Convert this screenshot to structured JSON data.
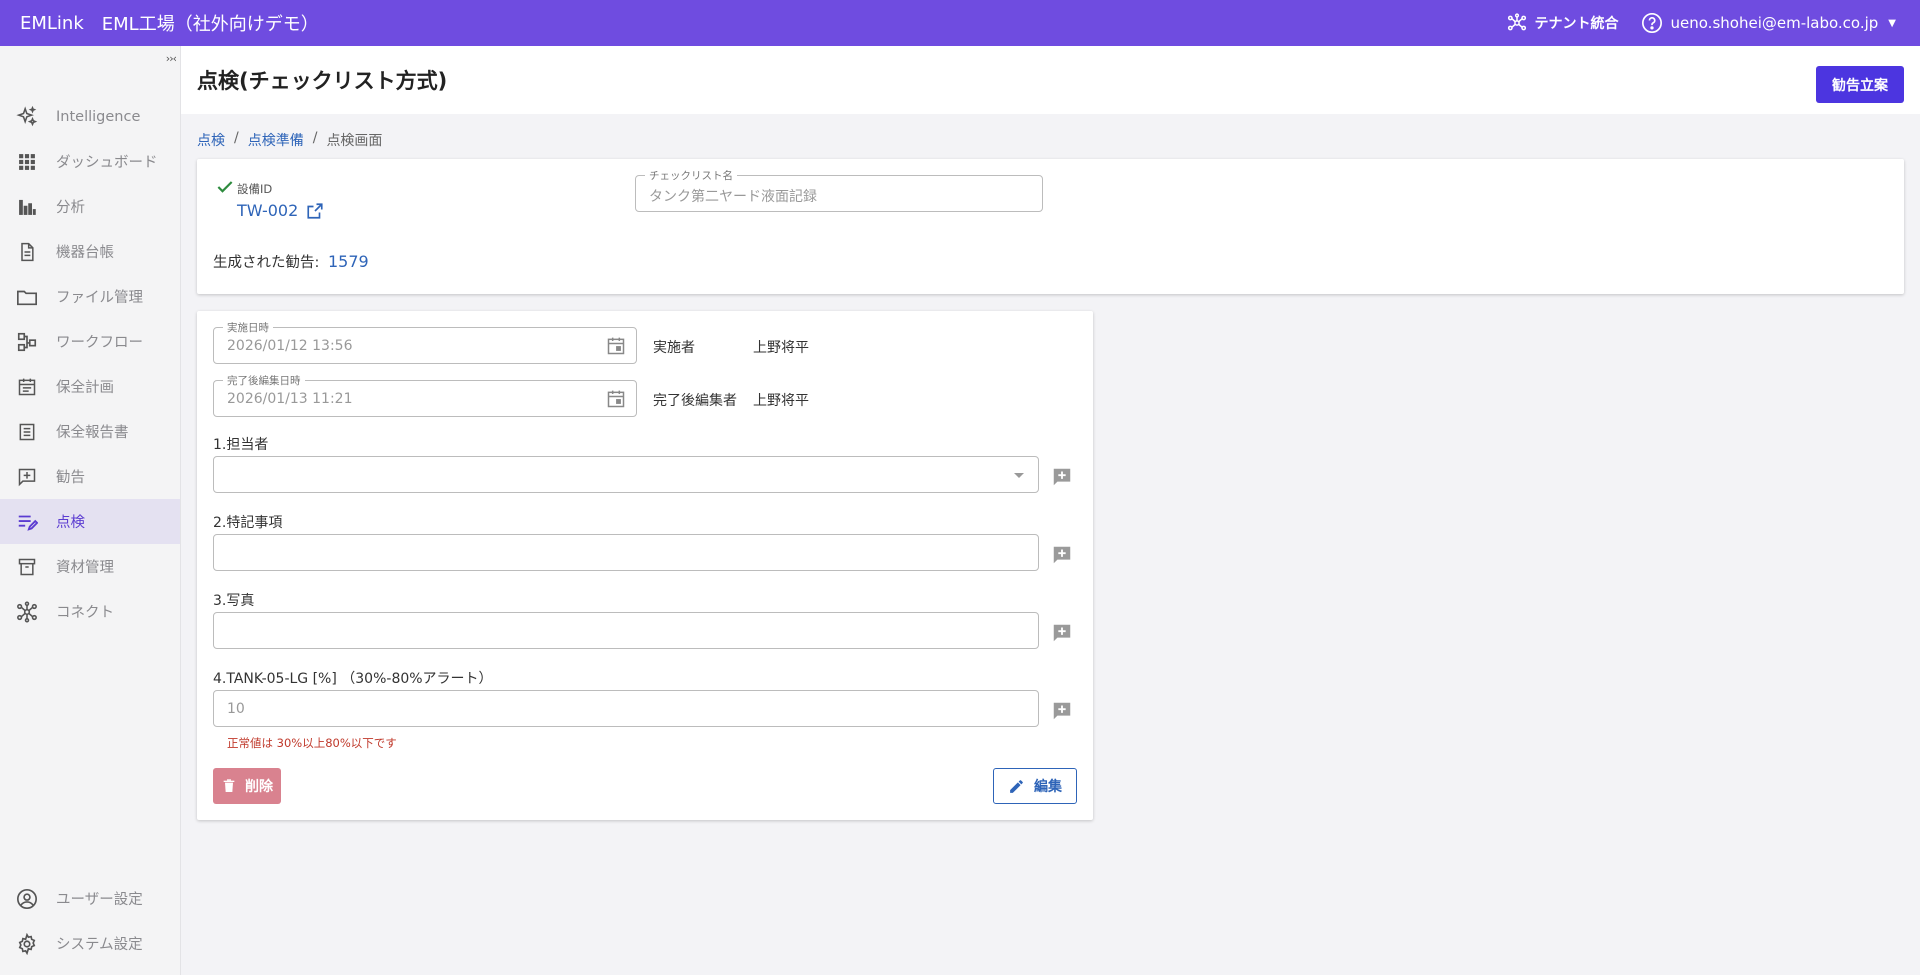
{
  "topbar": {
    "brand": "EMLink",
    "site": "EML工場（社外向けデモ）",
    "tenant_label": "テナント統合",
    "user_email": "ueno.shohei@em-labo.co.jp"
  },
  "sidebar": {
    "items": [
      {
        "label": "Intelligence",
        "icon": "sparkle-icon"
      },
      {
        "label": "ダッシュボード",
        "icon": "grid-icon"
      },
      {
        "label": "分析",
        "icon": "bar-chart-icon"
      },
      {
        "label": "機器台帳",
        "icon": "document-icon"
      },
      {
        "label": "ファイル管理",
        "icon": "folder-icon"
      },
      {
        "label": "ワークフロー",
        "icon": "workflow-icon"
      },
      {
        "label": "保全計画",
        "icon": "calendar-icon"
      },
      {
        "label": "保全報告書",
        "icon": "report-icon"
      },
      {
        "label": "勧告",
        "icon": "comment-plus-icon"
      },
      {
        "label": "点検",
        "icon": "checklist-edit-icon"
      },
      {
        "label": "資材管理",
        "icon": "archive-icon"
      },
      {
        "label": "コネクト",
        "icon": "hub-icon"
      }
    ],
    "bottom": [
      {
        "label": "ユーザー設定",
        "icon": "account-icon"
      },
      {
        "label": "システム設定",
        "icon": "gear-icon"
      }
    ]
  },
  "header": {
    "title": "点検(チェックリスト方式)",
    "action_label": "勧告立案"
  },
  "breadcrumb": [
    "点検",
    "点検準備",
    "点検画面"
  ],
  "summary": {
    "equipment_label": "設備ID",
    "equipment_id": "TW-002",
    "checklist_label": "チェックリスト名",
    "checklist_value": "タンク第二ヤード液面記録",
    "generated_label": "生成された勧告:",
    "generated_count": "1579"
  },
  "inspection": {
    "performed_at_label": "実施日時",
    "performed_at": "2026/01/12 13:56",
    "performer_label": "実施者",
    "performer": "上野将平",
    "edited_at_label": "完了後編集日時",
    "edited_at": "2026/01/13 11:21",
    "editor_label": "完了後編集者",
    "editor": "上野将平",
    "questions": [
      {
        "label": "1.担当者",
        "value": ""
      },
      {
        "label": "2.特記事項",
        "value": ""
      },
      {
        "label": "3.写真",
        "value": ""
      },
      {
        "label": "4.TANK-05-LG [%] （30%-80%アラート）",
        "value": "10"
      }
    ],
    "error_text": "正常値は 30%以上80%以下です",
    "delete_label": "削除",
    "edit_label": "編集"
  },
  "colors": {
    "topbar": "#6f4ce0",
    "primary": "#4c35e0",
    "link": "#2e64b8",
    "danger": "#d9828f",
    "error": "#c0392b"
  }
}
